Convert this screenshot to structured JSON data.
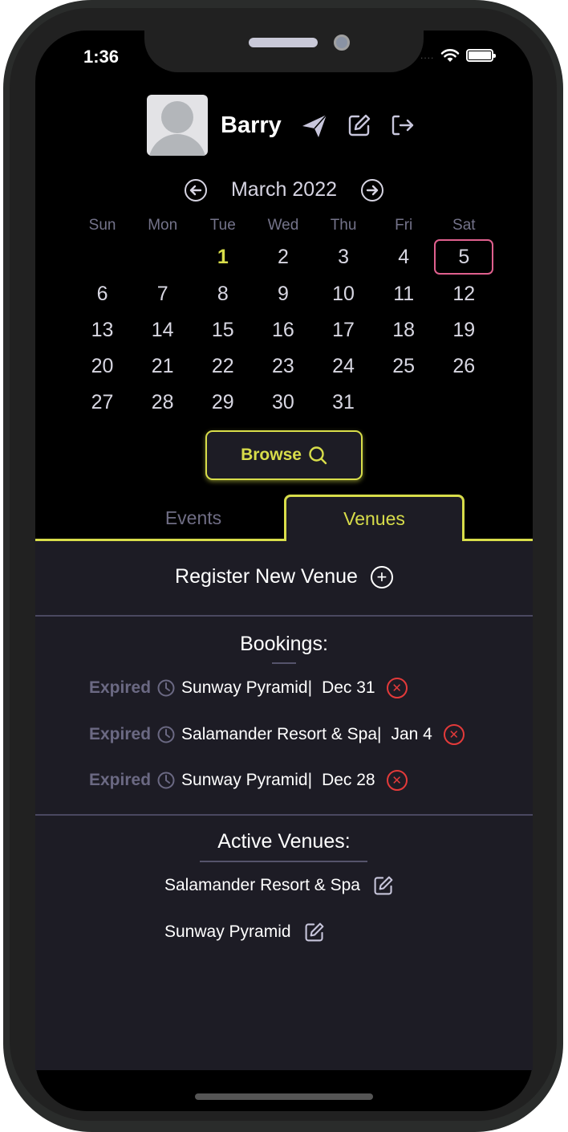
{
  "status_bar": {
    "time": "1:36",
    "signal": "....",
    "wifi_icon": "wifi-icon",
    "battery_icon": "battery-icon"
  },
  "header": {
    "user_name": "Barry",
    "icons": [
      "avatar-placeholder",
      "send-icon",
      "edit-icon",
      "logout-icon"
    ]
  },
  "calendar": {
    "month_label": "March 2022",
    "prev_icon": "arrow-left-circle-icon",
    "next_icon": "arrow-right-circle-icon",
    "weekdays": [
      "Sun",
      "Mon",
      "Tue",
      "Wed",
      "Thu",
      "Fri",
      "Sat"
    ],
    "weeks": [
      [
        "",
        "",
        "1",
        "2",
        "3",
        "4",
        "5"
      ],
      [
        "6",
        "7",
        "8",
        "9",
        "10",
        "11",
        "12"
      ],
      [
        "13",
        "14",
        "15",
        "16",
        "17",
        "18",
        "19"
      ],
      [
        "20",
        "21",
        "22",
        "23",
        "24",
        "25",
        "26"
      ],
      [
        "27",
        "28",
        "29",
        "30",
        "31",
        "",
        ""
      ]
    ],
    "today": "1",
    "selected": "5",
    "today_color": "#d8dd4a",
    "selected_color": "#e0608e"
  },
  "browse": {
    "label": "Browse",
    "icon": "search-icon"
  },
  "tabs": [
    {
      "label": "Events",
      "active": false
    },
    {
      "label": "Venues",
      "active": true
    }
  ],
  "accent_color": "#d8dd4a",
  "venues_panel": {
    "register_label": "Register New Venue",
    "register_icon": "plus-circle-icon",
    "bookings_title": "Bookings:",
    "bookings": [
      {
        "status": "Expired",
        "venue": "Sunway Pyramid|",
        "date": "Dec 31"
      },
      {
        "status": "Expired",
        "venue": "Salamander Resort & Spa|",
        "date": "Jan 4"
      },
      {
        "status": "Expired",
        "venue": "Sunway Pyramid|",
        "date": "Dec 28"
      }
    ],
    "active_title": "Active Venues:",
    "active_venues": [
      {
        "name": "Salamander Resort & Spa"
      },
      {
        "name": "Sunway Pyramid"
      }
    ]
  }
}
